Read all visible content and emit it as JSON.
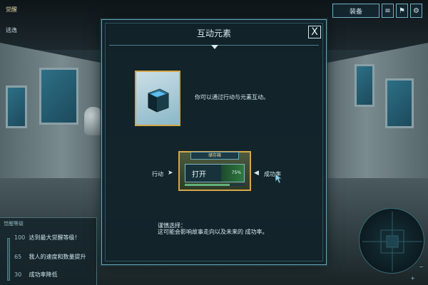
{
  "hud": {
    "top_left_title": "觉醒",
    "top_left_sub": "逃逸"
  },
  "toolbar": {
    "main_label": "装备",
    "icons": [
      "menu-icon",
      "flag-icon",
      "gear-icon"
    ]
  },
  "objectives": {
    "title": "觉醒等级",
    "rows": [
      {
        "num": "100",
        "text": "达到最大觉醒等级！"
      },
      {
        "num": "65",
        "text": "我人的速度和数量提升"
      },
      {
        "num": "30",
        "text": "成功率降低"
      }
    ]
  },
  "minimap": {
    "plus": "+",
    "minus": "−"
  },
  "modal": {
    "title": "互动元素",
    "close": "X",
    "item_description": "你可以通过行动与元素互动。",
    "action_card": {
      "tag": "储存箱",
      "label": "打开",
      "percent": "75%",
      "success_fraction": 0.75
    },
    "left_label": "行动",
    "right_label": "成功率",
    "note_line1": "谨慎选择：",
    "note_line2": "这可能会影响故事走向以及未来的 成功率。"
  },
  "colors": {
    "accent_border": "#6aa7b7",
    "gold_frame": "#d4a74a",
    "success_green": "#62b07a"
  }
}
